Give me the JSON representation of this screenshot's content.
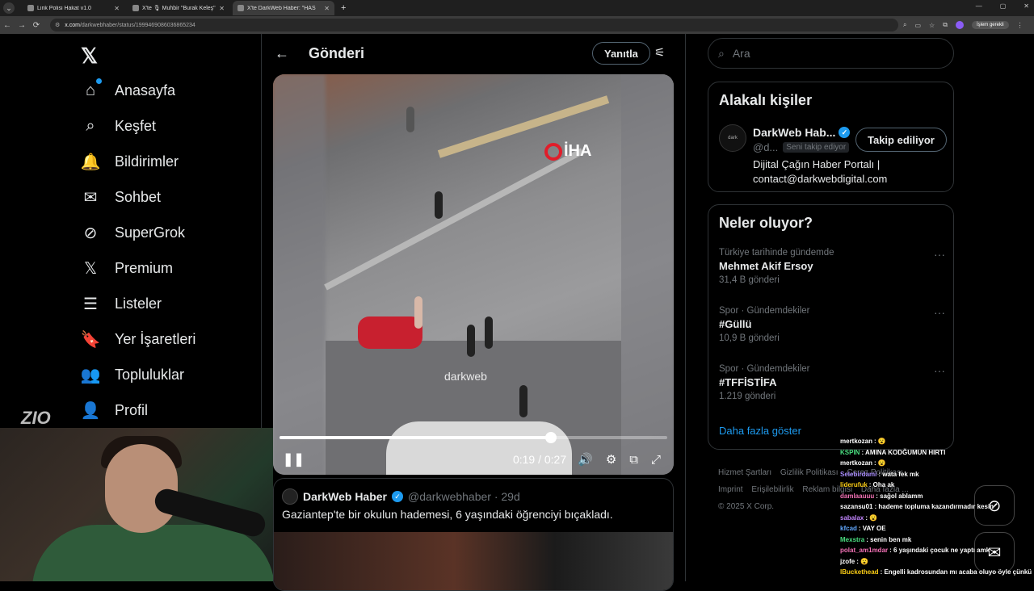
{
  "browser": {
    "tabs": [
      {
        "title": "Link Polisi Hakat v1.0",
        "active": false
      },
      {
        "title": "X'te 🎙 Muhbir \"Burak Keleş\"",
        "active": false
      },
      {
        "title": "X'te DarkWeb Haber: \"HAS",
        "active": true
      }
    ],
    "new_tab": "+",
    "url_host": "x.com",
    "url_path": "/darkwebhaber/status/1999469086036865234",
    "pill": "İşlem gerekli"
  },
  "sidebar": {
    "logo": "𝕏",
    "items": [
      {
        "label": "Anasayfa",
        "icon": "⌂"
      },
      {
        "label": "Keşfet",
        "icon": "⌕"
      },
      {
        "label": "Bildirimler",
        "icon": "🔔"
      },
      {
        "label": "Sohbet",
        "icon": "✉"
      },
      {
        "label": "SuperGrok",
        "icon": "⊘"
      },
      {
        "label": "Premium",
        "icon": "𝕏"
      },
      {
        "label": "Listeler",
        "icon": "☰"
      },
      {
        "label": "Yer İşaretleri",
        "icon": "🔖"
      },
      {
        "label": "Topluluklar",
        "icon": "👥"
      },
      {
        "label": "Profil",
        "icon": "👤"
      }
    ]
  },
  "main": {
    "title": "Gönderi",
    "reply_button": "Yanıtla",
    "video": {
      "brand": "İHA",
      "watermark": "darkweb",
      "time": "0:19 / 0:27",
      "progress": 0.7
    },
    "quote": {
      "name": "DarkWeb Haber",
      "handle": "@darkwebhaber · 29d",
      "text": "Gaziantep'te bir okulun hademesi, 6 yaşındaki öğrenciyi bıçakladı."
    }
  },
  "right": {
    "search_placeholder": "Ara",
    "related": {
      "title": "Alakalı kişiler",
      "name": "DarkWeb Hab...",
      "handle": "@d...",
      "follows_you": "Seni takip ediyor",
      "follow_button": "Takip ediliyor",
      "bio": "Dijital Çağın Haber Portalı | contact@darkwebdigital.com",
      "avatar_text": "dark"
    },
    "trends": {
      "title": "Neler oluyor?",
      "items": [
        {
          "category": "Türkiye tarihinde gündemde",
          "name": "Mehmet Akif Ersoy",
          "count": "31,4 B gönderi"
        },
        {
          "category": "Spor · Gündemdekiler",
          "name": "#Güllü",
          "count": "10,9 B gönderi"
        },
        {
          "category": "Spor · Gündemdekiler",
          "name": "#TFFİSTİFA",
          "count": "1.219 gönderi"
        }
      ],
      "show_more": "Daha fazla göster"
    },
    "footer": [
      "Hizmet Şartları",
      "Gizlilik Politikası",
      "Çerez Politikası",
      "Imprint",
      "Erişilebilirlik",
      "Reklam bilgisi",
      "Daha fazla ...",
      "© 2025 X Corp."
    ]
  },
  "overlay": {
    "streamer_logo": "ZIO",
    "chat": [
      {
        "user": "mertkozan",
        "msg": "😮",
        "color": "#fff"
      },
      {
        "user": "KSPIN",
        "msg": "AMINA KODĞUMUN HIRTI",
        "color": "#4ade80"
      },
      {
        "user": "mertkozan",
        "msg": "😮",
        "color": "#fff"
      },
      {
        "user": "Selebirdami",
        "msg": "wata fek mk",
        "color": "#a78bfa"
      },
      {
        "user": "liderufuk",
        "msg": "Oha ak",
        "color": "#facc15"
      },
      {
        "user": "damlaauuu",
        "msg": "sağol ablamm",
        "color": "#f472b6"
      },
      {
        "user": "sazansu01",
        "msg": "hademe topluma kazandırmadır kesin",
        "color": "#fff"
      },
      {
        "user": "sabalax",
        "msg": "😮",
        "color": "#c084fc"
      },
      {
        "user": "kfcad",
        "msg": "VAY OE",
        "color": "#60a5fa"
      },
      {
        "user": "Mexstra",
        "msg": "senin ben mk",
        "color": "#4ade80"
      },
      {
        "user": "polat_am1mdar",
        "msg": "6 yaşındaki çocuk ne yaptı amk",
        "color": "#f472b6"
      },
      {
        "user": "jzofe",
        "msg": "😮",
        "color": "#fff"
      },
      {
        "user": "lBuckethead",
        "msg": "Engelli kadrosundan mı acaba oluyo öyle çünkü",
        "color": "#facc15"
      }
    ]
  },
  "colors": {
    "accent": "#1d9bf0",
    "border": "#2f3336",
    "muted": "#71767b"
  }
}
